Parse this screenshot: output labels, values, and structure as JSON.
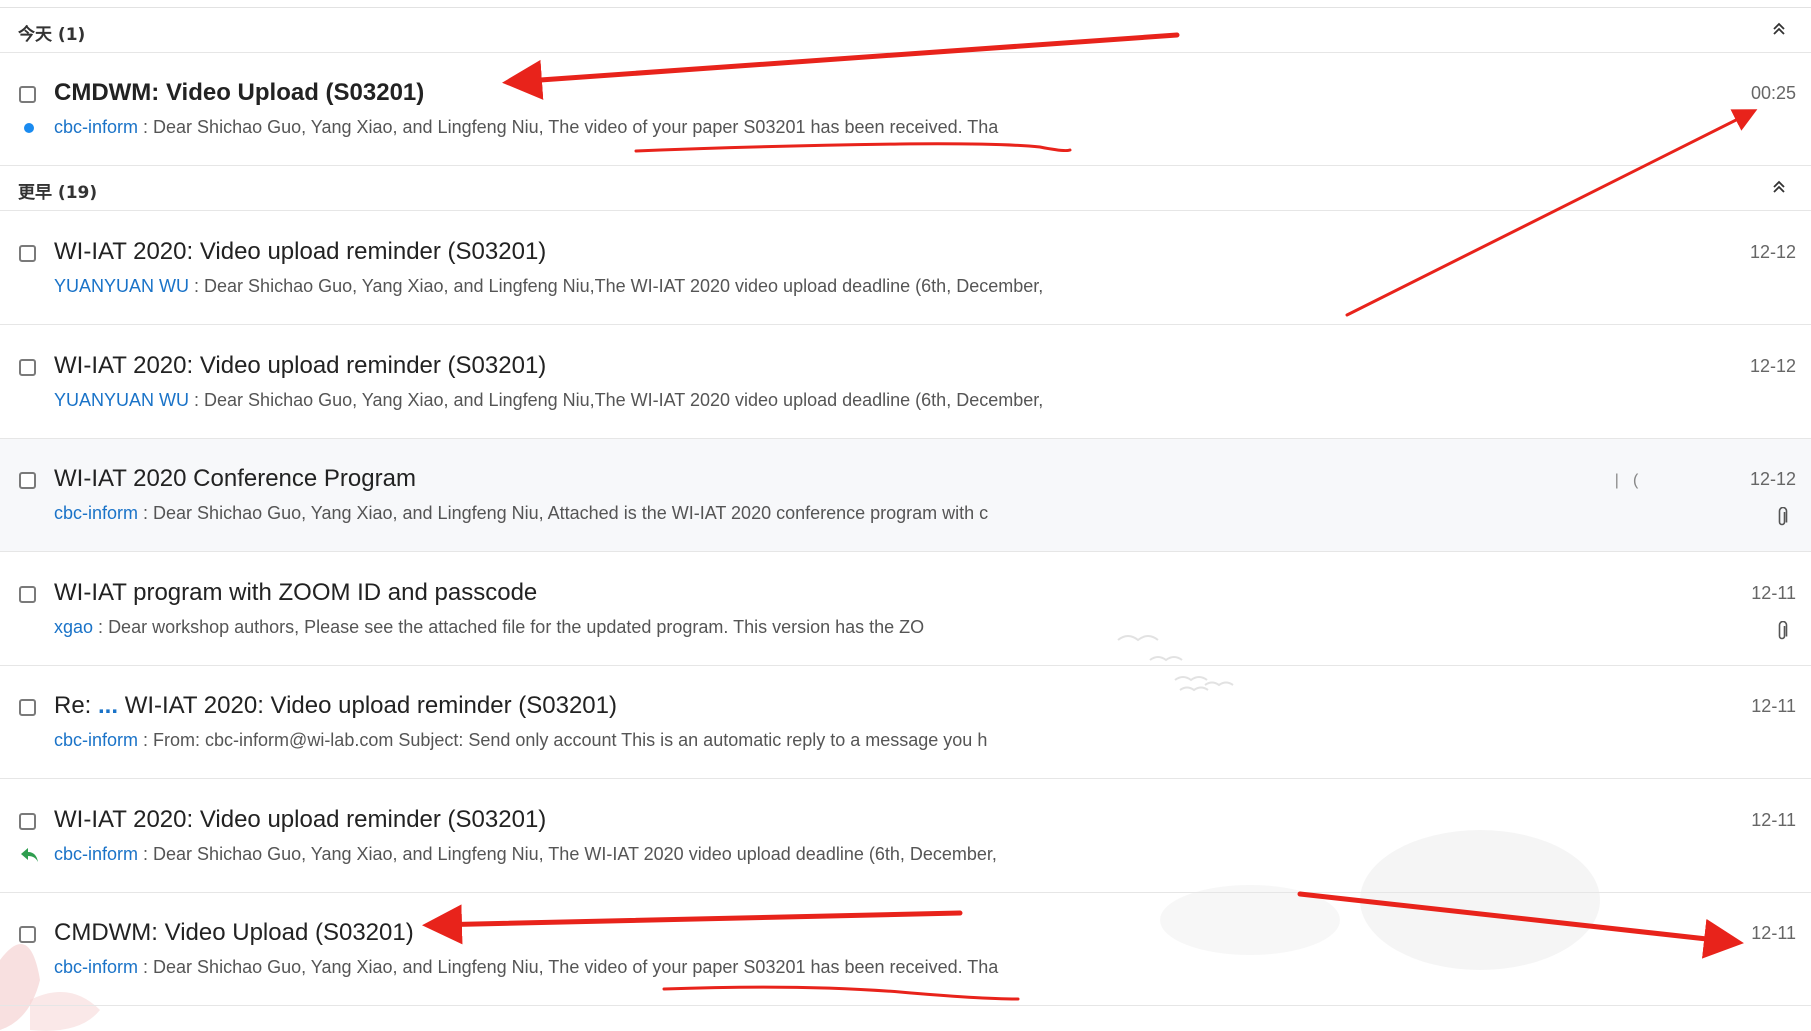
{
  "groups": [
    {
      "title": "今天 (1)"
    },
    {
      "title": "更早 (19)"
    }
  ],
  "mails": [
    {
      "subject": "CMDWM: Video Upload (S03201)",
      "sender": "cbc-inform",
      "separator": " : ",
      "preview": "Dear Shichao Guo, Yang Xiao, and Lingfeng Niu, The video of your paper S03201 has been received. Tha",
      "time": "00:25",
      "unread": true,
      "icon": "unread-dot-icon"
    },
    {
      "subject": "WI-IAT 2020: Video upload reminder (S03201)",
      "sender": "YUANYUAN WU",
      "separator": " : ",
      "preview": "Dear Shichao Guo, Yang Xiao, and Lingfeng Niu,The WI-IAT 2020 video upload deadline (6th, December,",
      "time": "12-12"
    },
    {
      "subject": "WI-IAT 2020: Video upload reminder (S03201)",
      "sender": "YUANYUAN WU",
      "separator": " : ",
      "preview": "Dear Shichao Guo, Yang Xiao, and Lingfeng Niu,The WI-IAT 2020 video upload deadline (6th, December,",
      "time": "12-12"
    },
    {
      "subject": "WI-IAT 2020 Conference Program",
      "sender": "cbc-inform",
      "separator": " : ",
      "preview": "Dear Shichao Guo, Yang Xiao, and Lingfeng Niu, Attached is the WI-IAT 2020 conference program with c",
      "time": "12-12",
      "icon": "paperclip-icon",
      "text_cursor": "| (",
      "hovered": true
    },
    {
      "subject": "WI-IAT program with ZOOM ID and passcode",
      "sender": "xgao",
      "separator": " : ",
      "preview": "Dear workshop authors, Please see the attached file for the updated program. This version has the ZO",
      "time": "12-11",
      "icon": "paperclip-icon"
    },
    {
      "subject_prefix": "Re: ",
      "subject_ellipsis": "...",
      "subject": " WI-IAT 2020: Video upload reminder (S03201)",
      "sender": "cbc-inform",
      "separator": " : ",
      "preview": "From: cbc-inform@wi-lab.com Subject: Send only account This is an automatic reply to a message you h",
      "time": "12-11"
    },
    {
      "subject": "WI-IAT 2020: Video upload reminder (S03201)",
      "sender": "cbc-inform",
      "separator": " : ",
      "preview": "Dear Shichao Guo, Yang Xiao, and Lingfeng Niu, The WI-IAT 2020 video upload deadline (6th, December,",
      "time": "12-11",
      "icon": "replied-arrow-icon"
    },
    {
      "subject": "CMDWM: Video Upload (S03201)",
      "sender": "cbc-inform",
      "separator": " : ",
      "preview": "Dear Shichao Guo, Yang Xiao, and Lingfeng Niu, The video of your paper S03201 has been received. Tha",
      "time": "12-11"
    }
  ],
  "colors": {
    "sender_link": "#1a73c8",
    "unread_dot": "#1a8bf0",
    "annotation_red": "#e8231b",
    "replied_green": "#2e9e4f",
    "ellipsis_blue": "#1a73c8"
  }
}
